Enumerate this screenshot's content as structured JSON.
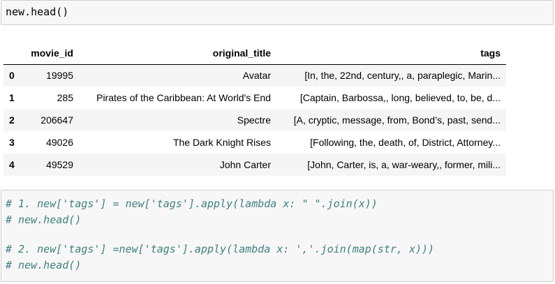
{
  "cells": {
    "top_code": "new.head()",
    "bottom_code": [
      "# 1. new['tags'] = new['tags'].apply(lambda x: \" \".join(x))",
      "# new.head()",
      "",
      "# 2. new['tags'] =new['tags'].apply(lambda x: ','.join(map(str, x)))",
      "# new.head()"
    ]
  },
  "table": {
    "columns": [
      "",
      "movie_id",
      "original_title",
      "tags"
    ],
    "rows": [
      {
        "index": "0",
        "movie_id": "19995",
        "original_title": "Avatar",
        "tags": "[In, the, 22nd, century,, a, paraplegic, Marin..."
      },
      {
        "index": "1",
        "movie_id": "285",
        "original_title": "Pirates of the Caribbean: At World's End",
        "tags": "[Captain, Barbossa,, long, believed, to, be, d..."
      },
      {
        "index": "2",
        "movie_id": "206647",
        "original_title": "Spectre",
        "tags": "[A, cryptic, message, from, Bond’s, past, send..."
      },
      {
        "index": "3",
        "movie_id": "49026",
        "original_title": "The Dark Knight Rises",
        "tags": "[Following, the, death, of, District, Attorney..."
      },
      {
        "index": "4",
        "movie_id": "49529",
        "original_title": "John Carter",
        "tags": "[John, Carter, is, a, war-weary,, former, mili..."
      }
    ]
  },
  "colors": {
    "cell_background": "#f7f7f7",
    "cell_border": "#cfcfcf",
    "comment_text": "#408080",
    "row_stripe": "#f5f5f5"
  }
}
